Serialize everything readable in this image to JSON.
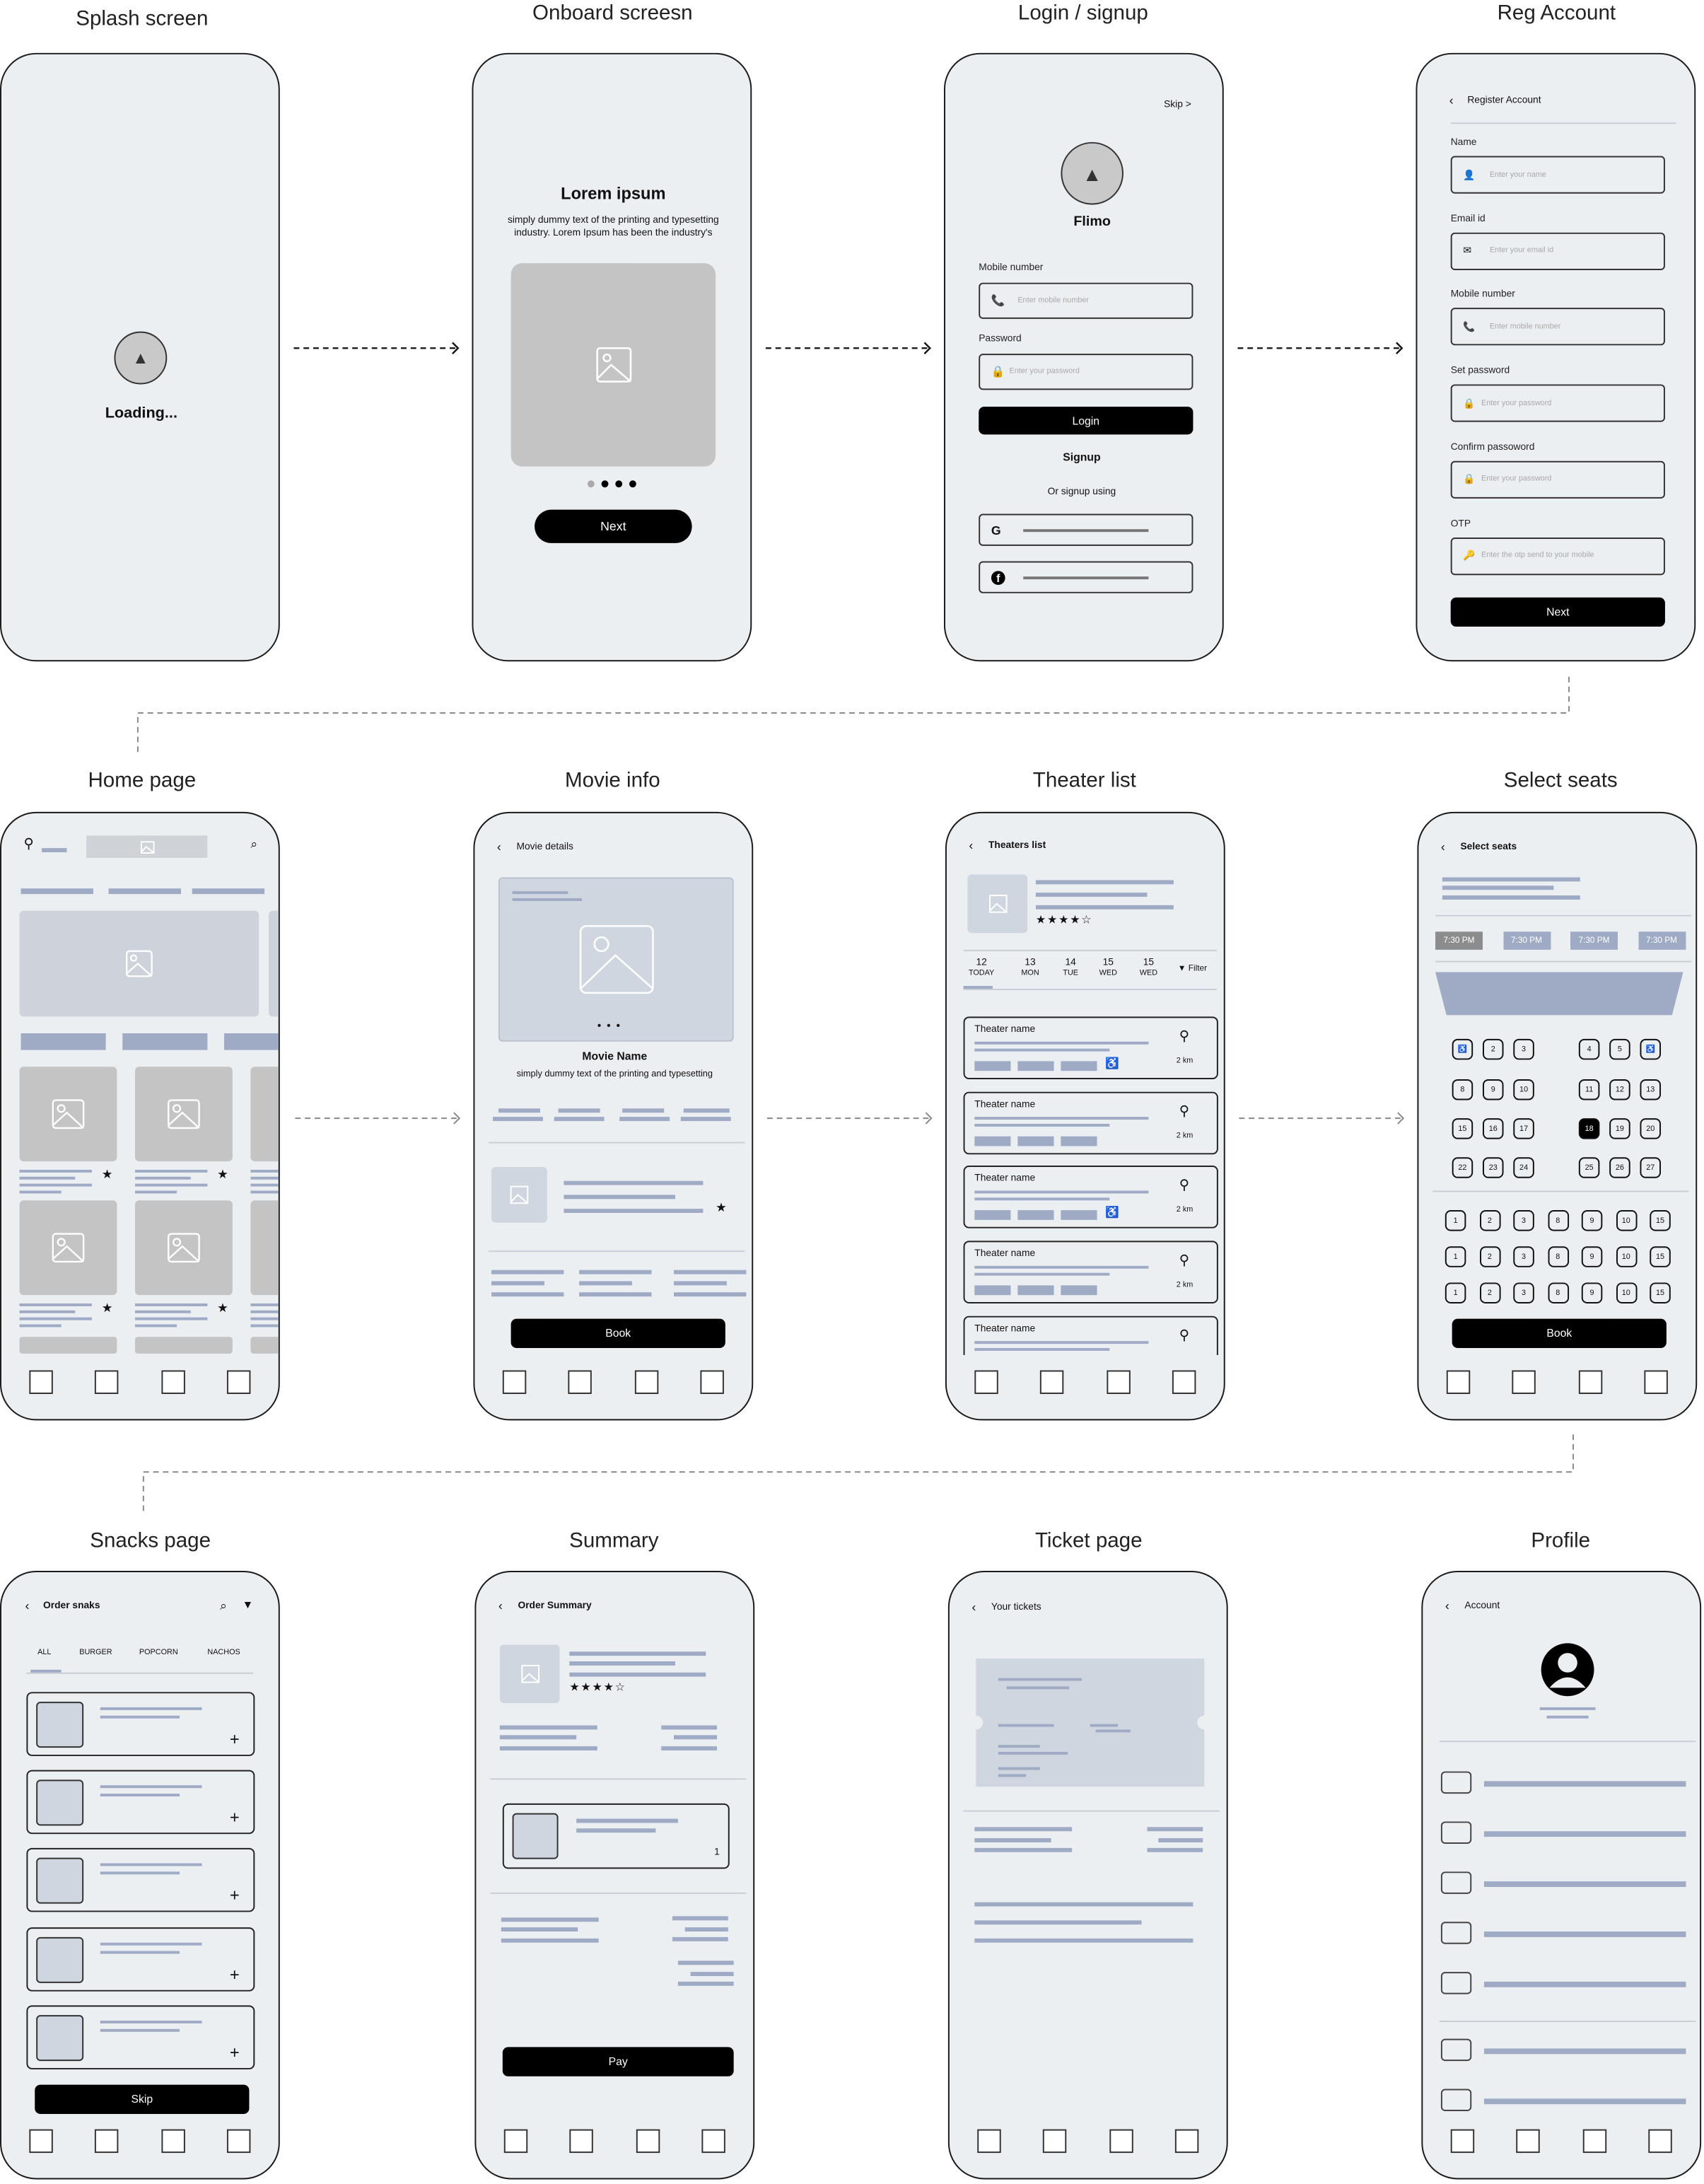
{
  "splash": {
    "title": "Splash screen",
    "loading": "Loading..."
  },
  "onboard": {
    "title": "Onboard screesn",
    "heading": "Lorem ipsum",
    "description": "simply dummy text of the printing and typesetting industry. Lorem Ipsum has been the industry's",
    "next": "Next",
    "page_count": 4,
    "active_page": 1
  },
  "login": {
    "title": "Login / signup",
    "skip": "Skip >",
    "app_name": "Flimo",
    "mobile_label": "Mobile number",
    "mobile_placeholder": "Enter mobile number",
    "password_label": "Password",
    "password_placeholder": "Enter your password",
    "login": "Login",
    "signup": "Signup",
    "or_signup": "Or signup using",
    "social": [
      "google-icon",
      "facebook-icon"
    ]
  },
  "register": {
    "title": "Reg Account",
    "header": "Register Account",
    "fields": [
      {
        "label": "Name",
        "placeholder": "Enter your name",
        "icon": "user-icon",
        "glyph": "👤"
      },
      {
        "label": "Email id",
        "placeholder": "Enter your email id",
        "icon": "mail-icon",
        "glyph": "✉"
      },
      {
        "label": "Mobile number",
        "placeholder": "Enter mobile number",
        "icon": "phone-icon",
        "glyph": "📞"
      },
      {
        "label": "Set password",
        "placeholder": "Enter your password",
        "icon": "lock-icon",
        "glyph": "🔒"
      },
      {
        "label": "Confirm passoword",
        "placeholder": "Enter your password",
        "icon": "lock-icon",
        "glyph": "🔒"
      },
      {
        "label": "OTP",
        "placeholder": "Enter the otp send to your mobile",
        "icon": "key-icon",
        "glyph": "🔑"
      }
    ],
    "next": "Next"
  },
  "home": {
    "title": "Home page"
  },
  "movie": {
    "title": "Movie info",
    "header": "Movie details",
    "movie_name": "Movie Name",
    "description": "simply dummy text of the printing and typesetting",
    "book": "Book"
  },
  "theaters": {
    "title": "Theater list",
    "header": "Theaters list",
    "rating": 4,
    "rating_max": 5,
    "dates": [
      {
        "day": "12",
        "label": "TODAY"
      },
      {
        "day": "13",
        "label": "MON"
      },
      {
        "day": "14",
        "label": "TUE"
      },
      {
        "day": "15",
        "label": "WED"
      },
      {
        "day": "15",
        "label": "WED"
      }
    ],
    "filter": "Filter",
    "list": [
      {
        "name": "Theater name",
        "distance": "2 km",
        "accessible": true
      },
      {
        "name": "Theater name",
        "distance": "2 km",
        "accessible": false
      },
      {
        "name": "Theater name",
        "distance": "2 km",
        "accessible": true
      },
      {
        "name": "Theater name",
        "distance": "2 km",
        "accessible": false
      },
      {
        "name": "Theater name",
        "distance": "",
        "accessible": false
      }
    ]
  },
  "seats": {
    "title": "Select seats",
    "header": "Select seats",
    "times": [
      "7:30 PM",
      "7:30 PM",
      "7:30 PM",
      "7:30 PM"
    ],
    "selected_time": 0,
    "premium_rows": [
      [
        "♿",
        "2",
        "3",
        "4",
        "5",
        "♿"
      ],
      [
        "8",
        "9",
        "10",
        "11",
        "12",
        "13"
      ],
      [
        "15",
        "16",
        "17",
        "18",
        "19",
        "20"
      ],
      [
        "22",
        "23",
        "24",
        "25",
        "26",
        "27"
      ]
    ],
    "selected_seat": "18",
    "standard_rows": [
      [
        "1",
        "2",
        "3",
        "8",
        "9",
        "10",
        "15"
      ],
      [
        "1",
        "2",
        "3",
        "8",
        "9",
        "10",
        "15"
      ],
      [
        "1",
        "2",
        "3",
        "8",
        "9",
        "10",
        "15"
      ]
    ],
    "book": "Book"
  },
  "snacks": {
    "title": "Snacks page",
    "header": "Order snaks",
    "tabs": [
      "ALL",
      "BURGER",
      "POPCORN",
      "NACHOS"
    ],
    "active_tab": 0,
    "item_count": 5,
    "skip": "Skip"
  },
  "summary": {
    "title": "Summary",
    "header": "Order Summary",
    "rating": 4,
    "quantity": "1",
    "pay": "Pay"
  },
  "ticket": {
    "title": "Ticket page",
    "header": "Your tickets"
  },
  "profile": {
    "title": "Profile",
    "header": "Account"
  },
  "colors": {
    "background": "#eceff2",
    "placeholder": "#9fabc4",
    "button": "#000000"
  }
}
